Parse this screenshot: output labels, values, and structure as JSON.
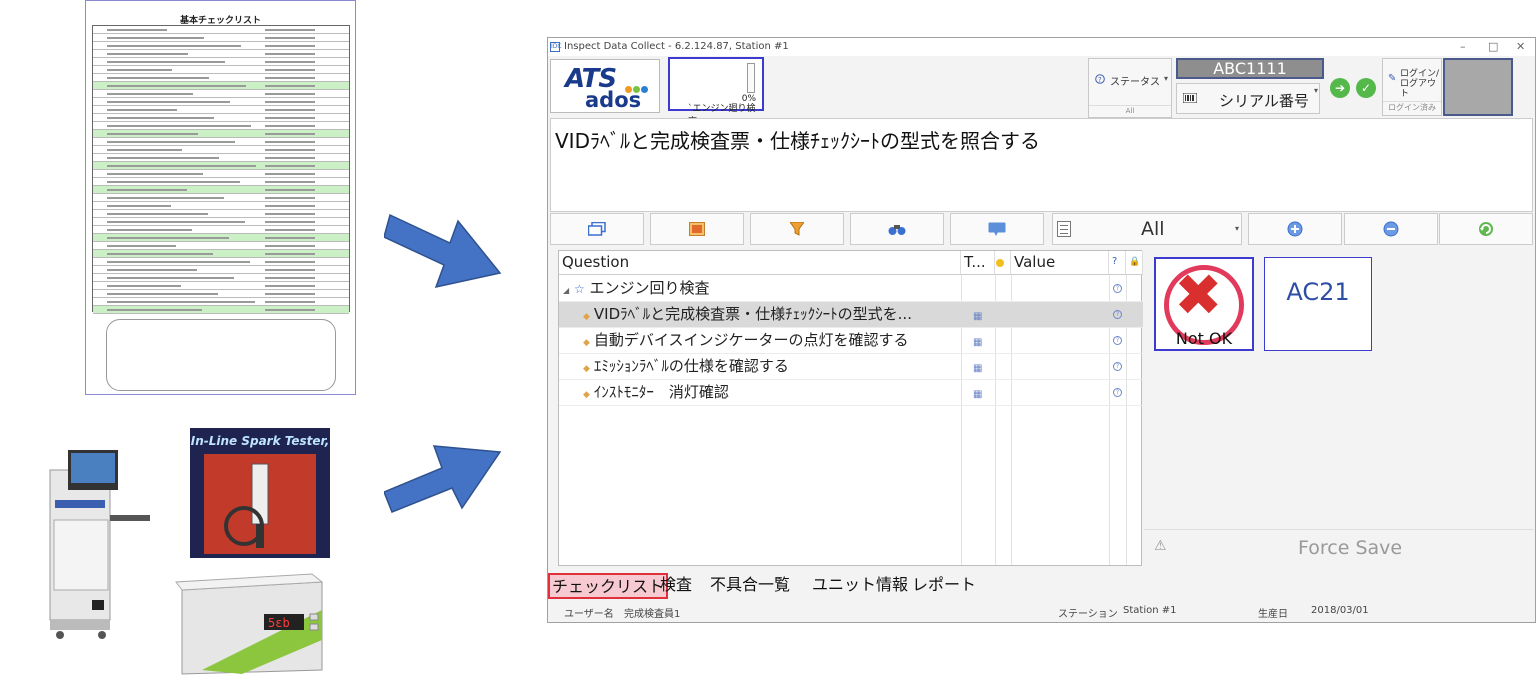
{
  "window": {
    "title": "Inspect Data Collect - 6.2.124.87, Station #1",
    "controls": [
      "–",
      "□",
      "✕"
    ]
  },
  "logo": {
    "top": "ATS",
    "bottom": "ados"
  },
  "progress": {
    "percent_label": "0%",
    "value": 0,
    "label": "`エンジン廻り検査"
  },
  "status": {
    "label": "ステータス",
    "value": "All"
  },
  "serial": {
    "value": "ABC1111",
    "label": "シリアル番号"
  },
  "login": {
    "label_line1": "ログイン/",
    "label_line2": "ログアウト",
    "status": "ログイン済み"
  },
  "instruction": "VIDﾗﾍﾞﾙと完成検査票・仕様ﾁｪｯｸｼｰﾄの型式を照合する",
  "toolbar": {
    "filter_value": "All",
    "icons": [
      "window-icon",
      "image-icon",
      "filter-icon",
      "binoculars-icon",
      "comment-icon",
      "checklist-icon",
      "add-icon",
      "remove-icon",
      "refresh-icon"
    ]
  },
  "table": {
    "headers": {
      "question": "Question",
      "type": "T...",
      "value": "Value",
      "help": "?",
      "lock": "🔒"
    },
    "group": "エンジン回り検査",
    "rows": [
      {
        "question": "VIDﾗﾍﾞﾙと完成検査票・仕様ﾁｪｯｸｼｰﾄの型式を..."
      },
      {
        "question": "自動デバイスインジケーターの点灯を確認する"
      },
      {
        "question": "ｴﾐｯｼｮﾝﾗﾍﾞﾙの仕様を確認する"
      },
      {
        "question": "ｲﾝｽﾄﾓﾆﾀｰ　消灯確認"
      }
    ]
  },
  "result": {
    "ng_label": "Not OK",
    "code": "AC21"
  },
  "force_save": "Force Save",
  "tabs": [
    "チェックリスト",
    "検査",
    "不具合一覧",
    "ユニット情報",
    "レポート"
  ],
  "statusbar": {
    "user_label": "ユーザー名",
    "user_value": "完成検査員1",
    "station_label": "ステーション",
    "station_value": "Station #1",
    "date_label": "生産日",
    "date_value": "2018/03/01"
  },
  "illustrations": {
    "checklist_title": "基本チェックリスト",
    "spark_title": "In-Line Spark Tester,",
    "tester_display": "5εb"
  },
  "colors": {
    "accent_blue": "#3b3bd0",
    "ng_red": "#d9302f",
    "ok_green": "#55b84a",
    "active_tab": "#f7c9d0"
  }
}
